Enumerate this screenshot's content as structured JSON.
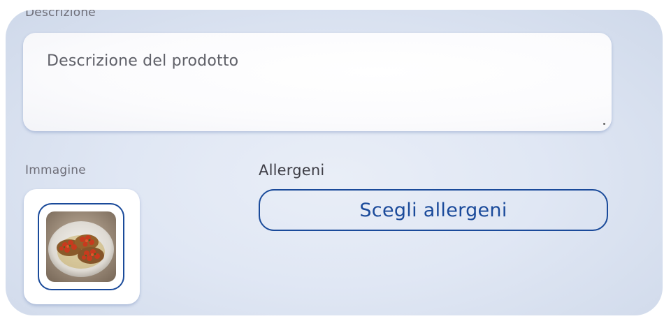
{
  "description": {
    "label": "Descrizione",
    "placeholder": "Descrizione del prodotto"
  },
  "image": {
    "label": "Immagine",
    "photo_icon": "bruschetta-photo"
  },
  "allergens": {
    "label": "Allergeni",
    "button_label": "Scegli allergeni"
  },
  "colors": {
    "accent": "#1a4a9a",
    "panel_background": "#e3e9f5",
    "label_text": "#6e6e78"
  }
}
